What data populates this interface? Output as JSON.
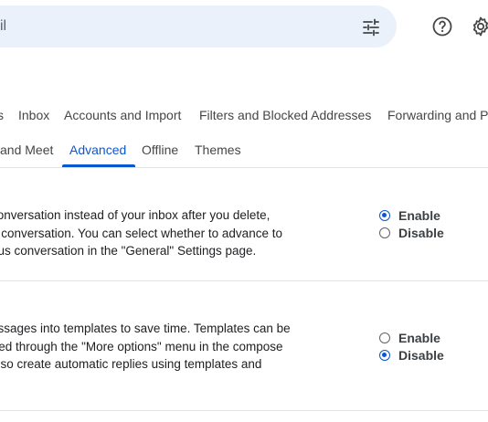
{
  "search": {
    "placeholder_fragment": "il"
  },
  "tabs_row1": [
    {
      "label": "s",
      "active": false
    },
    {
      "label": "Inbox",
      "active": false
    },
    {
      "label": "Accounts and Import",
      "active": false
    },
    {
      "label": "Filters and Blocked Addresses",
      "active": false
    },
    {
      "label": "Forwarding and P",
      "active": false
    }
  ],
  "tabs_row2": [
    {
      "label": "and Meet",
      "active": false
    },
    {
      "label": "Advanced",
      "active": true
    },
    {
      "label": "Offline",
      "active": false
    },
    {
      "label": "Themes",
      "active": false
    }
  ],
  "settings": [
    {
      "description_lines": [
        "conversation instead of your inbox after you delete,",
        "a conversation. You can select whether to advance to",
        "ous conversation in the \"General\" Settings page."
      ],
      "options": [
        {
          "label": "Enable",
          "checked": true
        },
        {
          "label": "Disable",
          "checked": false
        }
      ]
    },
    {
      "description_lines": [
        "essages into templates to save time. Templates can be",
        "rted through the \"More options\" menu in the compose",
        "also create automatic replies using templates and"
      ],
      "options": [
        {
          "label": "Enable",
          "checked": false
        },
        {
          "label": "Disable",
          "checked": true
        }
      ]
    }
  ],
  "colors": {
    "accent": "#0b57d0",
    "search_bg": "#eaf1fb",
    "divider": "#e3e3e3"
  },
  "icons": [
    "tune-icon",
    "help-icon",
    "gear-icon"
  ]
}
